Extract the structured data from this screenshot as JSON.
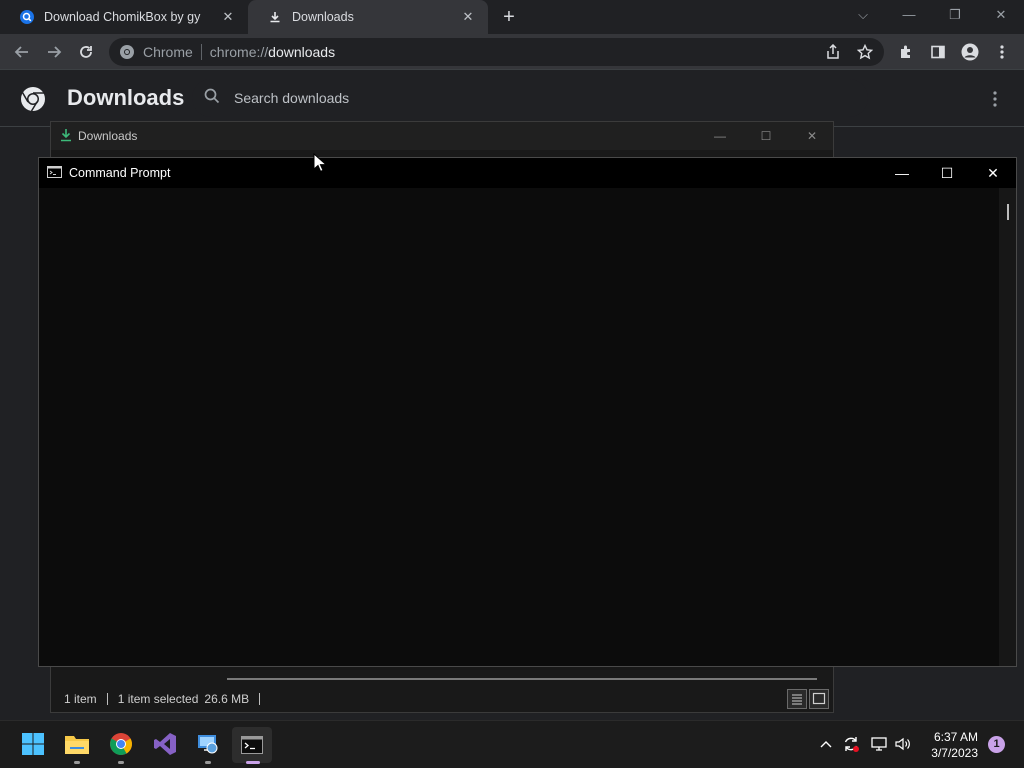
{
  "browser": {
    "tabs": [
      {
        "title": "Download ChomikBox by gy",
        "close": "✕"
      },
      {
        "title": "Downloads",
        "close": "✕"
      }
    ],
    "new_tab": "+",
    "window_controls": {
      "search_tabs": "⌵",
      "minimize": "—",
      "restore": "❐",
      "close": "✕"
    },
    "omnibox": {
      "chip": "Chrome",
      "scheme": "chrome://",
      "host": "downloads"
    }
  },
  "downloads_page": {
    "title": "Downloads",
    "search_placeholder": "Search downloads"
  },
  "explorer_window": {
    "title": "Downloads",
    "controls": {
      "minimize": "—",
      "maximize": "☐",
      "close": "✕"
    },
    "status": {
      "items": "1 item",
      "selected": "1 item selected",
      "size": "26.6 MB"
    }
  },
  "cmd_window": {
    "title": "Command Prompt",
    "controls": {
      "minimize": "—",
      "maximize": "☐",
      "close": "✕"
    }
  },
  "taskbar": {
    "apps": [
      "start-icon",
      "file-explorer-icon",
      "chrome-icon",
      "visual-studio-icon",
      "control-panel-icon",
      "terminal-icon"
    ],
    "clock": {
      "time": "6:37 AM",
      "date": "3/7/2023"
    },
    "notification_count": "1"
  },
  "colors": {
    "accent_green": "#3dba7a",
    "chrome_dark": "#202124",
    "toolbar": "#35363a"
  }
}
